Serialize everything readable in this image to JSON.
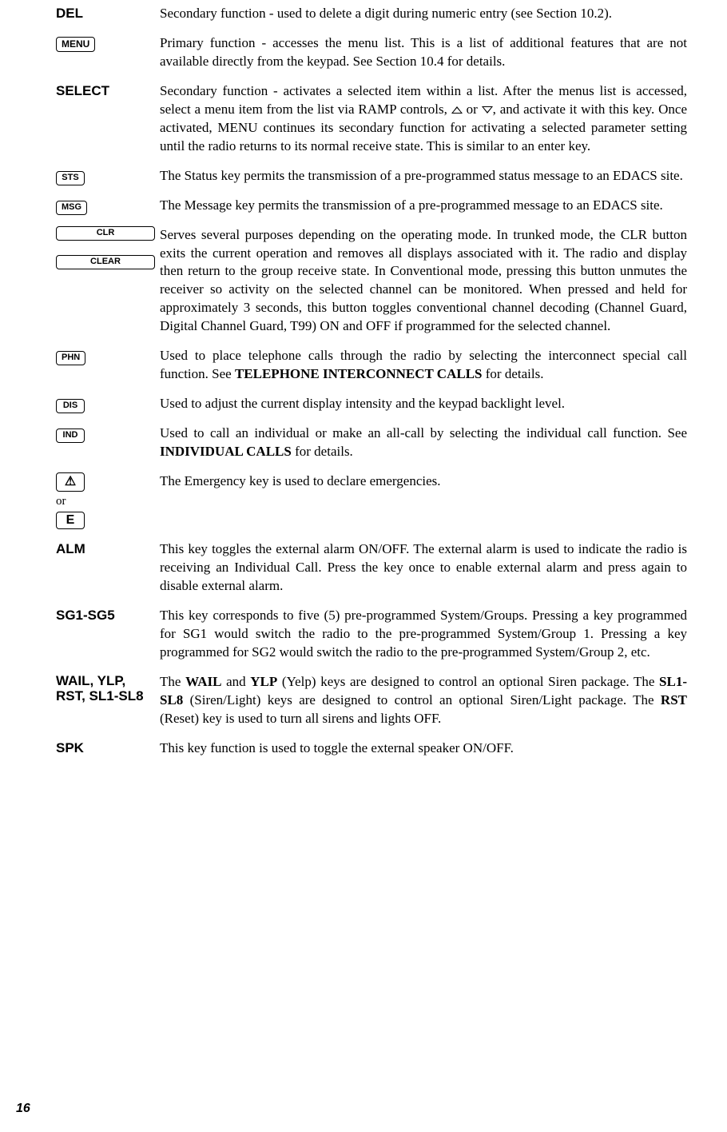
{
  "page_number": "16",
  "rows": [
    {
      "key_label": "DEL",
      "key_style": "bold",
      "desc": "Secondary function - used to delete a digit during numeric entry (see Section 10.2)."
    },
    {
      "key_label": "MENU",
      "key_style": "cap",
      "desc": "Primary function - accesses the menu list.  This is a list of additional features that are not available directly from the keypad.  See Section 10.4 for details."
    },
    {
      "key_label": "SELECT",
      "key_style": "bold",
      "desc_html": "Secondary function - activates a selected item within a list.  After the menus list is accessed, select a menu item from the list via RAMP controls, <span class='tri-up' data-name='ramp-up-icon' data-interactable='false'></span> or <span class='tri-down' data-name='ramp-down-icon' data-interactable='false'></span>, and activate it with this key.  Once activated, MENU continues its secondary function for activating a selected parameter setting until the radio returns to its normal receive state.  This is similar to an enter key."
    },
    {
      "key_label": "STS",
      "key_style": "cap-small",
      "desc": "The Status key permits the transmission of a pre-programmed status message to an EDACS site."
    },
    {
      "key_label": "MSG",
      "key_style": "cap-small",
      "desc": "The Message key permits the transmission of a pre-programmed message to an EDACS site."
    },
    {
      "key_stack": [
        "CLR",
        "CLEAR"
      ],
      "key_style": "cap-small",
      "desc": "Serves several purposes depending on the operating mode.  In trunked mode, the CLR button exits the current operation and removes all displays associated with it.  The radio and display then return to the group receive state.  In Conventional mode, pressing this button unmutes the receiver so activity on the selected channel can be monitored.  When pressed and held for approximately 3 seconds, this button toggles conventional channel decoding (Channel Guard, Digital Channel Guard, T99) ON and OFF if programmed for the selected channel."
    },
    {
      "key_label": "PHN",
      "key_style": "cap-small",
      "desc_html": "Used to place telephone calls through the radio by selecting the interconnect special call function.  See <span class='inline-bold'>TELEPHONE INTERCONNECT CALLS</span> for details."
    },
    {
      "key_label": "DIS",
      "key_style": "cap-small",
      "desc": "Used to adjust the current display intensity and the keypad backlight level."
    },
    {
      "key_label": "IND",
      "key_style": "cap-small",
      "desc_html": "Used to call an individual or make an all-call by selecting the individual call function.  See <span class='inline-bold'>INDIVIDUAL CALLS</span> for details."
    },
    {
      "key_emergency": true,
      "or_text": "or",
      "e_label": "E",
      "desc": "The Emergency key is used to declare emergencies."
    },
    {
      "key_label": "ALM",
      "key_style": "bold",
      "desc": "This key toggles the external alarm ON/OFF.  The external alarm is used to indicate the radio is receiving an Individual Call.  Press the key once to enable external alarm and press again to disable external alarm."
    },
    {
      "key_label": "SG1-SG5",
      "key_style": "bold",
      "desc": "This key corresponds to five (5) pre-programmed System/Groups.  Pressing a key programmed for SG1 would switch the radio to the pre-programmed System/Group 1.  Pressing a key programmed for SG2 would switch the radio to the pre-programmed System/Group 2, etc."
    },
    {
      "key_label": "WAIL, YLP, RST, SL1-SL8",
      "key_style": "bold tight",
      "desc_html": "The <span class='inline-bold'>WAIL</span> and <span class='inline-bold'>YLP</span> (Yelp) keys are designed to control an optional Siren package.  The <span class='inline-bold'>SL1-SL8</span> (Siren/Light) keys are designed to control an optional Siren/Light package.  The <span class='inline-bold'>RST</span> (Reset) key is used to turn all sirens and lights OFF."
    },
    {
      "key_label": "SPK",
      "key_style": "bold",
      "desc": "This key function is used to toggle the external speaker ON/OFF."
    }
  ]
}
